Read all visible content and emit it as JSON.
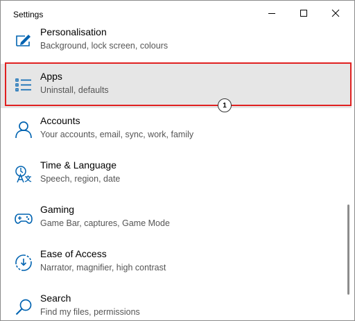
{
  "window": {
    "title": "Settings",
    "minimize_icon": "minimize-icon",
    "maximize_icon": "maximize-icon",
    "close_icon": "close-icon"
  },
  "items": [
    {
      "label": "Personalisation",
      "description": "Background, lock screen, colours",
      "icon": "personalisation-icon"
    },
    {
      "label": "Apps",
      "description": "Uninstall, defaults",
      "icon": "apps-icon",
      "selected": true
    },
    {
      "label": "Accounts",
      "description": "Your accounts, email, sync, work, family",
      "icon": "person-icon"
    },
    {
      "label": "Time & Language",
      "description": "Speech, region, date",
      "icon": "time-language-icon"
    },
    {
      "label": "Gaming",
      "description": "Game Bar, captures, Game Mode",
      "icon": "gamepad-icon"
    },
    {
      "label": "Ease of Access",
      "description": "Narrator, magnifier, high contrast",
      "icon": "ease-of-access-icon"
    },
    {
      "label": "Search",
      "description": "Find my files, permissions",
      "icon": "search-icon"
    }
  ],
  "annotation": {
    "number": "1",
    "color": "#e02020"
  },
  "colors": {
    "accent": "#0063b1",
    "selected_bg": "#e6e6e6"
  }
}
